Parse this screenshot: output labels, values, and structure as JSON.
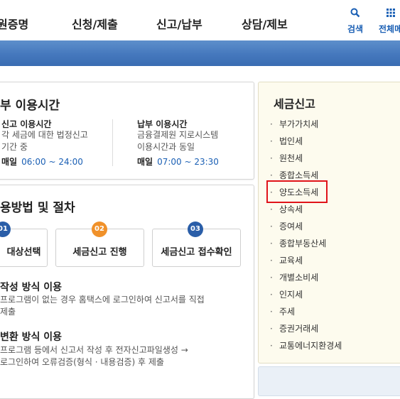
{
  "nav": {
    "items": [
      "원증명",
      "신청/제출",
      "신고/납부",
      "상담/제보"
    ],
    "search_label": "검색",
    "allmenu_label": "전체메"
  },
  "hours": {
    "title": "부 이용시간",
    "filing": {
      "title": "신고 이용시간",
      "desc": [
        "각 세금에 대한 법정신고",
        "기간 중"
      ],
      "daily_label": "매일",
      "daily_time": "06:00 ~ 24:00"
    },
    "payment": {
      "title": "납부 이용시간",
      "desc": [
        "금융결제원 지로시스템",
        "이용시간과 동일"
      ],
      "daily_label": "매일",
      "daily_time": "07:00 ~ 23:30"
    }
  },
  "procedure": {
    "title": "용방법 및 절차",
    "steps": [
      {
        "num": "01",
        "label": "대상선택",
        "color": "#2a5ea8"
      },
      {
        "num": "02",
        "label": "세금신고 진행",
        "color": "#f0912a"
      },
      {
        "num": "03",
        "label": "세금신고 접수확인",
        "color": "#2a5ea8"
      }
    ],
    "methods": [
      {
        "title": "작성 방식 이용",
        "lines": [
          "프로그램이 없는 경우 홈택스에 로그인하여 신고서를 직접",
          "제출"
        ]
      },
      {
        "title": "변환 방식 이용",
        "lines": [
          "프로그램 등에서 신고서 작성 후 전자신고파일생성 →",
          "로그인하여 오류검증(형식 · 내용검증) 후 제출"
        ]
      }
    ]
  },
  "sidebar": {
    "title": "세금신고",
    "items": [
      "부가가치세",
      "법인세",
      "원천세",
      "종합소득세",
      "양도소득세",
      "상속세",
      "증여세",
      "종합부동산세",
      "교육세",
      "개별소비세",
      "인지세",
      "주세",
      "증권거래세",
      "교통에너지환경세"
    ],
    "highlighted_index": 4
  },
  "colors": {
    "banner": "#4578bd",
    "accent_blue": "#1a5fb4",
    "highlight": "#e0131a",
    "sidebar_bg": "#fdfbee"
  }
}
